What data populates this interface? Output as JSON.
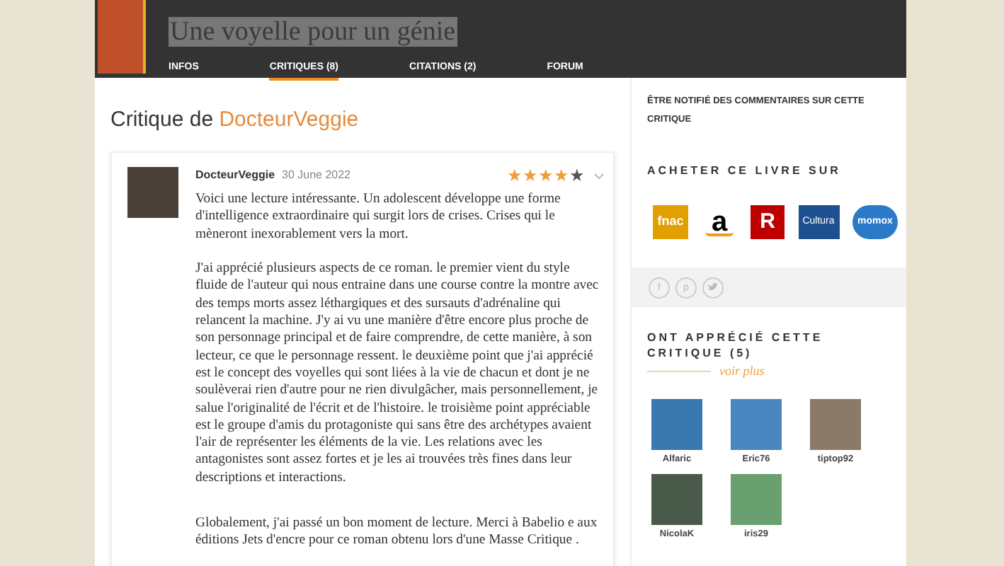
{
  "book": {
    "title": "Une voyelle pour un génie"
  },
  "tabs": [
    {
      "label": "INFOS",
      "selected": false
    },
    {
      "label": "CRITIQUES (8)",
      "selected": true
    },
    {
      "label": "CITATIONS (2)",
      "selected": false
    },
    {
      "label": "FORUM",
      "selected": false
    }
  ],
  "review": {
    "heading": "Critique de ",
    "author_link": "DocteurVeggie",
    "author": "DocteurVeggie",
    "date": "30 June 2022",
    "stars": 4,
    "paragraphs": [
      "Voici une lecture intéressante. Un adolescent développe une forme d'intelligence extraordinaire qui surgit lors de crises. Crises qui le mèneront inexorablement vers la mort.",
      "J'ai apprécié plusieurs aspects de ce roman. le premier vient du style fluide de l'auteur qui nous entraine dans une course contre la montre avec des temps morts assez léthargiques et des sursauts d'adrénaline qui relancent la machine. J'y ai vu une manière d'être encore plus proche de son personnage principal et de faire comprendre, de cette manière, à son lecteur, ce que le personnage ressent. le deuxième point que j'ai apprécié est le concept des voyelles qui sont liées à la vie de chacun et dont je ne soulèverai rien d'autre pour ne rien divulgâcher, mais personnellement, je salue l'originalité de l'écrit et de l'histoire. le troisième point appréciable est le groupe d'amis du protagoniste qui sans être des archétypes avaient l'air de représenter les éléments de la vie. Les relations avec les antagonistes sont assez fortes et je les ai trouvées très fines dans leur descriptions et interactions.",
      "Globalement, j'ai passé un bon moment de lecture. Merci à Babelio e aux éditions Jets d'encre pour ce roman obtenu lors d'une Masse Critique ."
    ]
  },
  "sidebar": {
    "notify": "ÊTRE NOTIFIÉ DES COMMENTAIRES SUR CETTE CRITIQUE",
    "buy_heading": "ACHETER CE LIVRE SUR",
    "stores": [
      {
        "kind": "fnac",
        "label": "fnac"
      },
      {
        "kind": "amazon",
        "label": "a"
      },
      {
        "kind": "rakuten",
        "label": "R"
      },
      {
        "kind": "cultura",
        "label": "Cultura"
      },
      {
        "kind": "momox",
        "label": "momox"
      }
    ],
    "share": [
      {
        "kind": "glyph",
        "label": "f"
      },
      {
        "kind": "glyph",
        "label": "p"
      },
      {
        "kind": "bird"
      }
    ],
    "liked_heading": "ONT APPRÉCIÉ CETTE CRITIQUE (5)",
    "see_more": "voir plus",
    "users": [
      {
        "name": "Alfaric",
        "color": "#3a78b0"
      },
      {
        "name": "Eric76",
        "color": "#4a86c0"
      },
      {
        "name": "tiptop92",
        "color": "#8a7a6a"
      },
      {
        "name": "NicolaK",
        "color": "#4a5a4a"
      },
      {
        "name": "iris29",
        "color": "#6aa070"
      }
    ]
  }
}
